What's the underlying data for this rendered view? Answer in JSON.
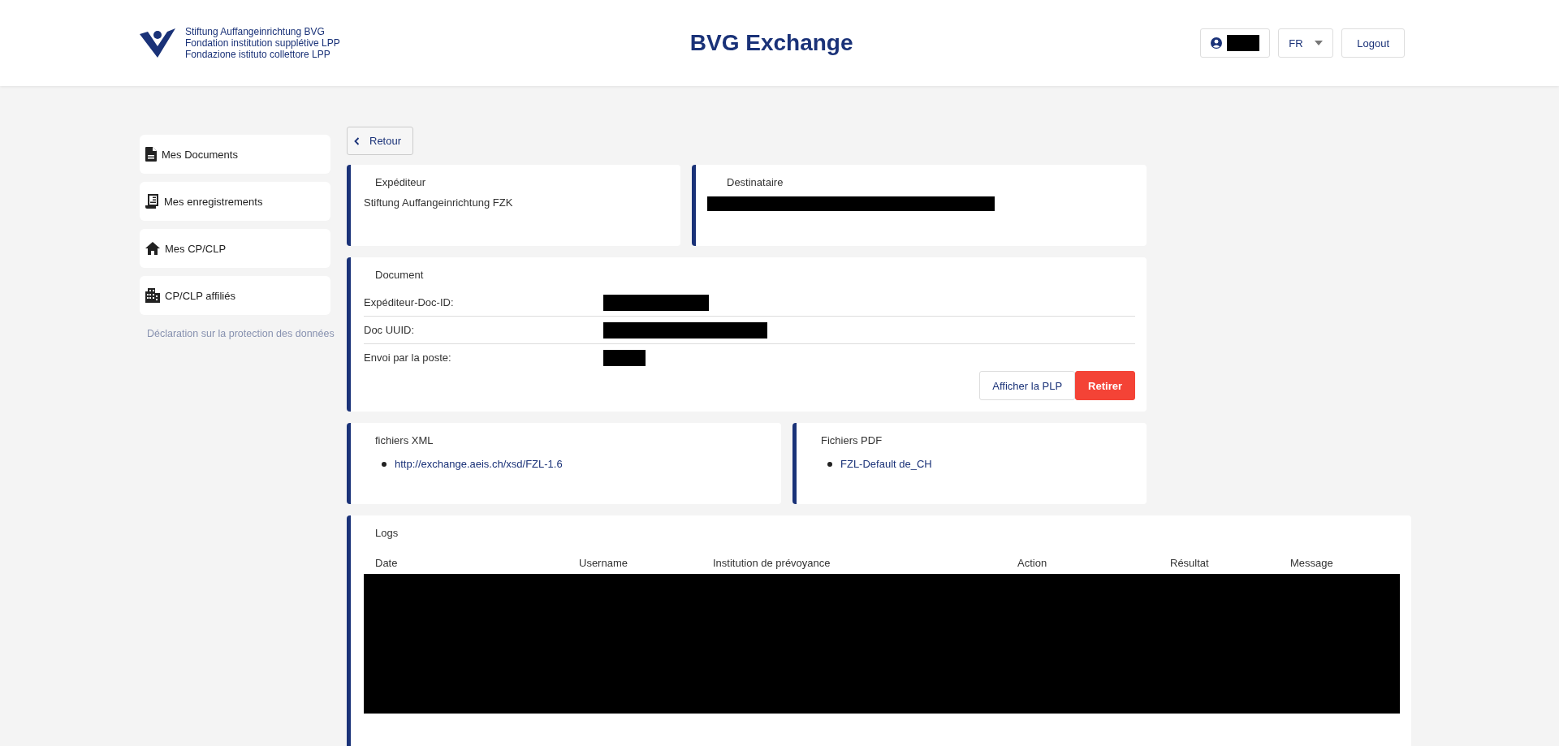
{
  "header": {
    "logo_lines": [
      "Stiftung Auffangeinrichtung BVG",
      "Fondation institution supplétive LPP",
      "Fondazione istituto collettore LPP"
    ],
    "title": "BVG Exchange",
    "language": "FR",
    "logout": "Logout"
  },
  "sidebar": {
    "items": [
      {
        "label": "Mes Documents",
        "kind": "document"
      },
      {
        "label": "Mes enregistrements",
        "kind": "register"
      },
      {
        "label": "Mes CP/CLP",
        "kind": "home"
      },
      {
        "label": "CP/CLP affiliés",
        "kind": "building"
      }
    ],
    "privacy_link": "Déclaration sur la protection des données"
  },
  "back_button": "Retour",
  "sender": {
    "title": "Expéditeur",
    "value": "Stiftung Auffangeinrichtung FZK"
  },
  "recipient": {
    "title": "Destinataire"
  },
  "document": {
    "title": "Document",
    "fields": [
      {
        "label": "Expéditeur-Doc-ID:"
      },
      {
        "label": "Doc UUID:"
      },
      {
        "label": "Envoi par la poste:"
      }
    ],
    "buttons": [
      {
        "label": "Afficher la PLP",
        "kind": "outline"
      },
      {
        "label": "Retirer",
        "kind": "danger"
      }
    ]
  },
  "xml_files": {
    "title": "fichiers XML",
    "items": [
      "http://exchange.aeis.ch/xsd/FZL-1.6"
    ]
  },
  "pdf_files": {
    "title": "Fichiers PDF",
    "items": [
      "FZL-Default de_CH"
    ]
  },
  "logs": {
    "title": "Logs",
    "columns": [
      "Date",
      "Username",
      "Institution de prévoyance",
      "Action",
      "Résultat",
      "Message"
    ]
  }
}
